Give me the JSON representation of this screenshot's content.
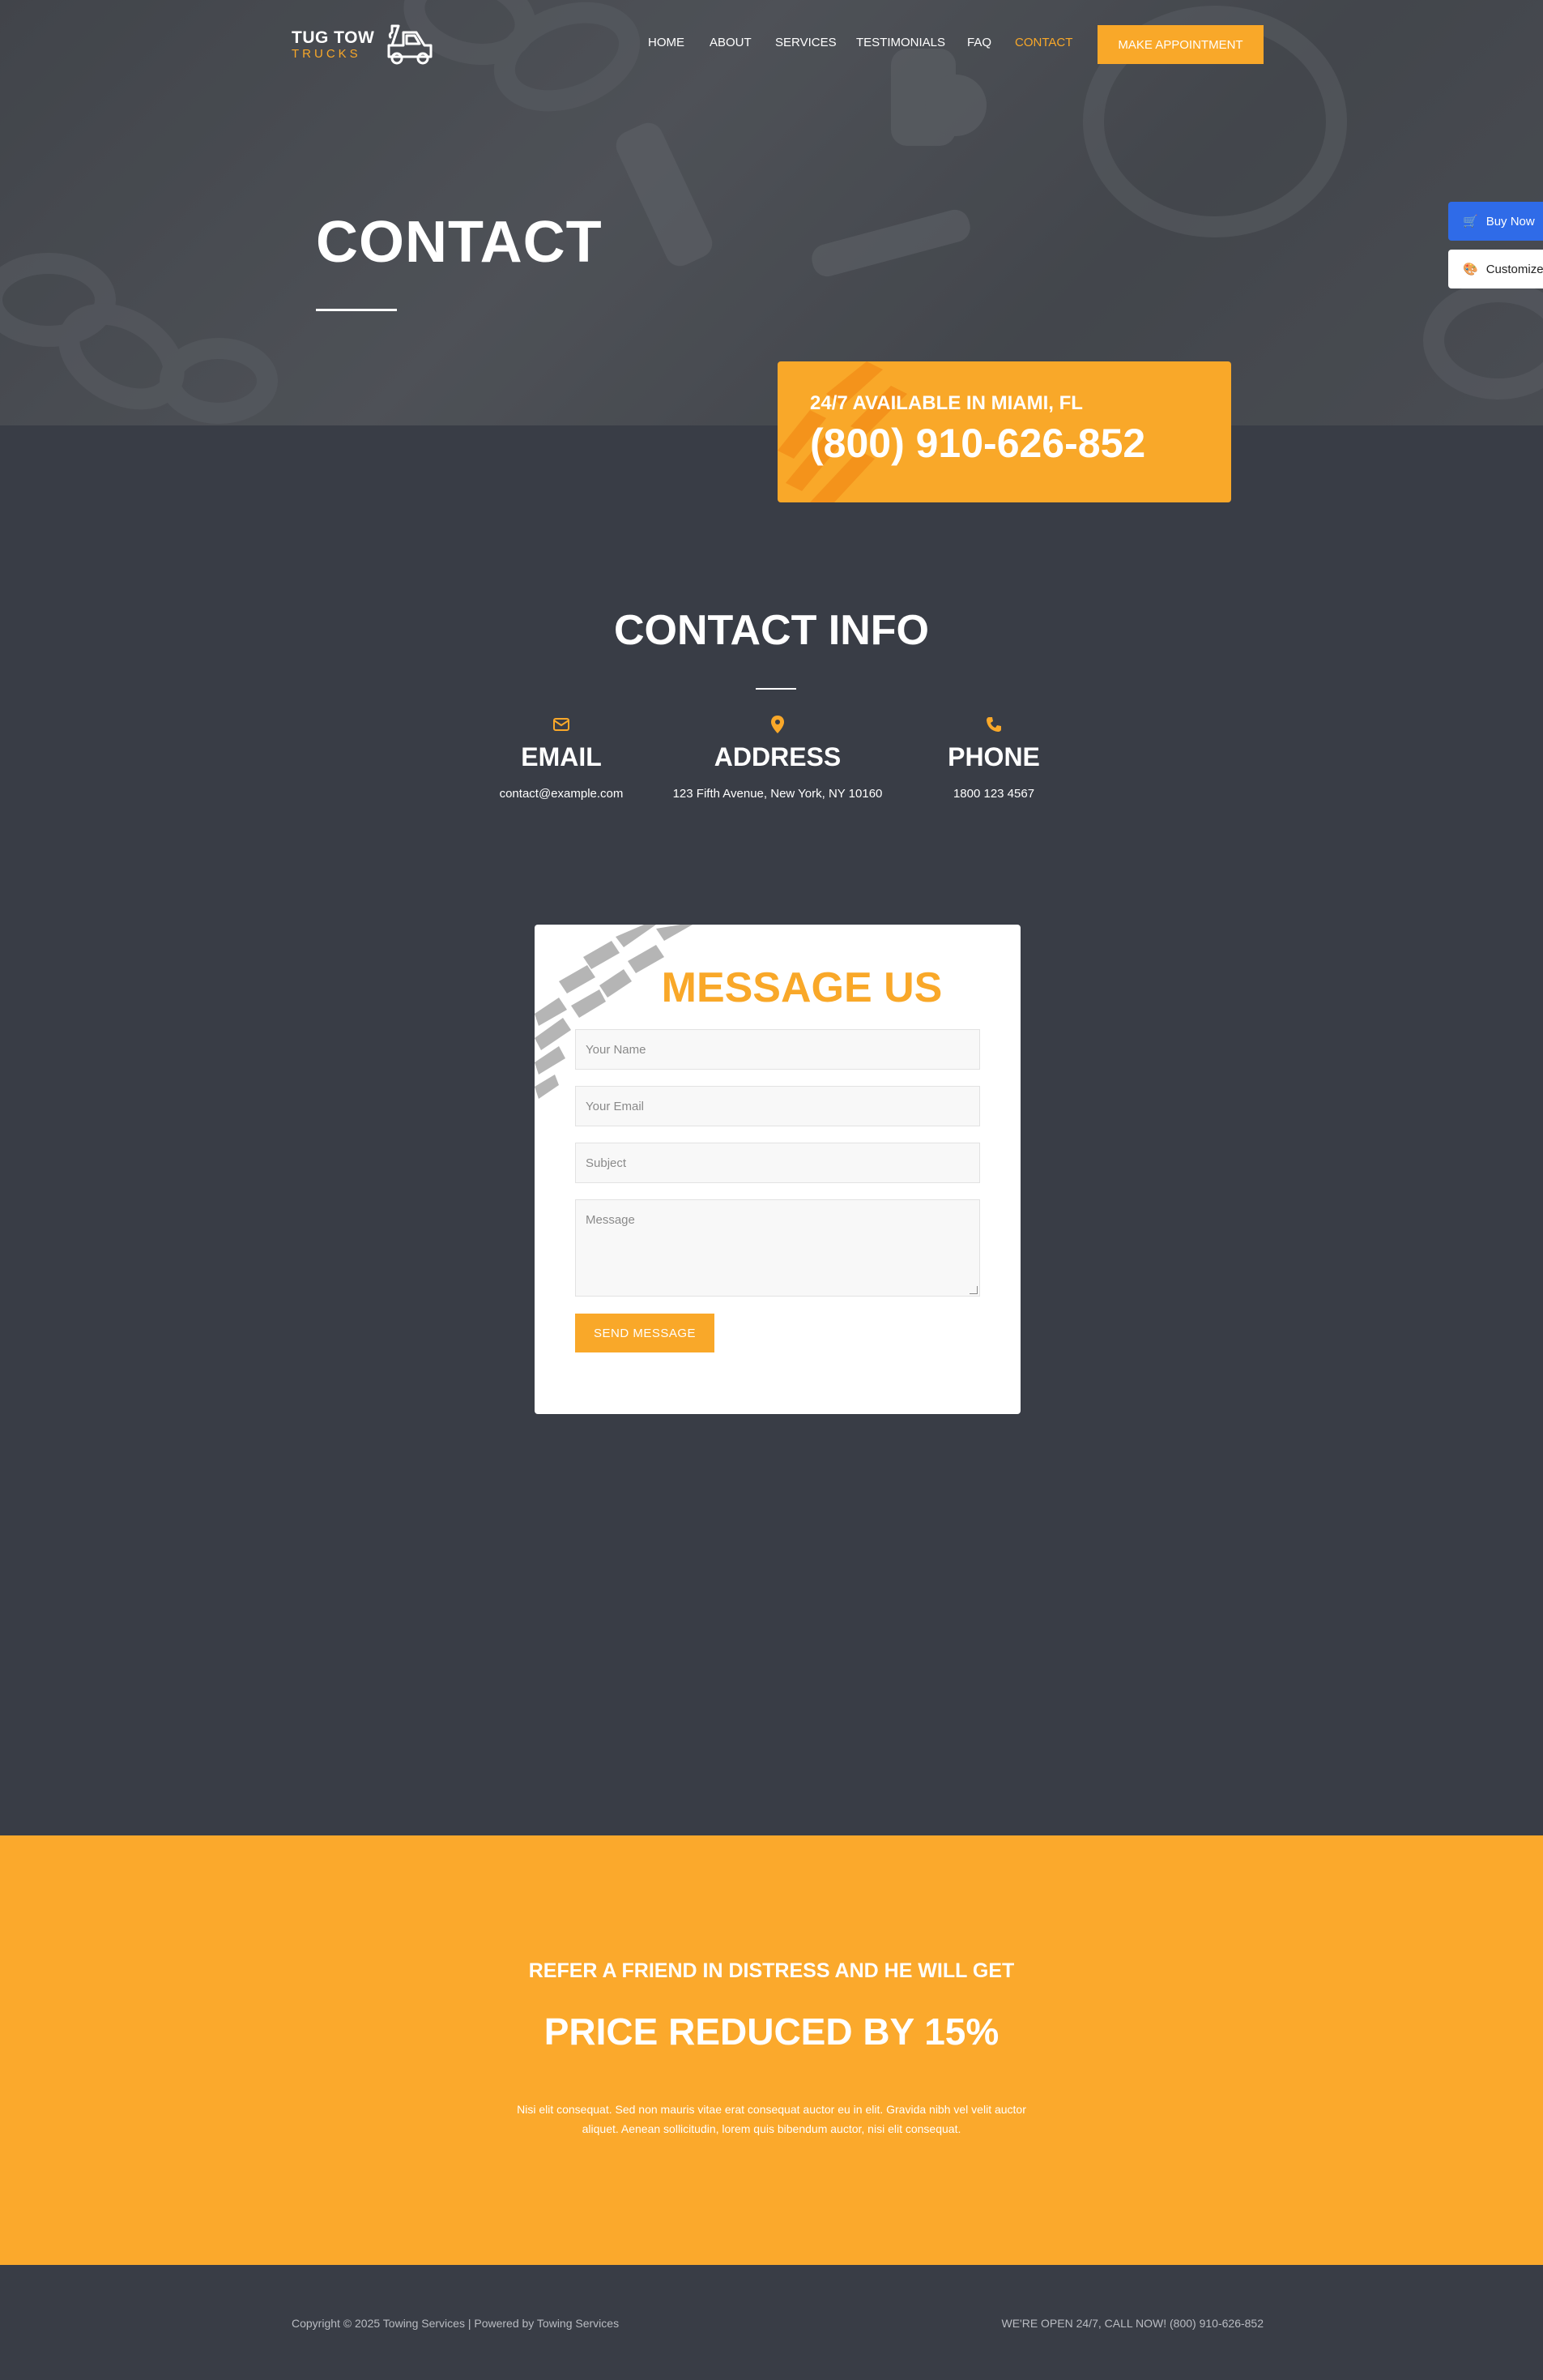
{
  "brand": {
    "top": "TUG TOW",
    "bottom": "TRUCKS",
    "accent_color": "#f9a829"
  },
  "nav": {
    "items": [
      "HOME",
      "ABOUT",
      "SERVICES",
      "TESTIMONIALS",
      "FAQ",
      "CONTACT"
    ],
    "active": "CONTACT",
    "cta": "MAKE APPOINTMENT"
  },
  "side": {
    "buy": "Buy Now",
    "customize": "Customize",
    "buy_icon": "cart-icon",
    "customize_icon": "palette-icon",
    "buy_color": "#2f6be8"
  },
  "hero": {
    "title": "CONTACT"
  },
  "call": {
    "small": "24/7 AVAILABLE IN MIAMI, FL",
    "phone": "(800) 910-626-852"
  },
  "contact_info": {
    "title": "CONTACT INFO",
    "items": [
      {
        "icon": "envelope-icon",
        "label": "EMAIL",
        "value": "contact@example.com"
      },
      {
        "icon": "map-marker-icon",
        "label": "ADDRESS",
        "value": "123 Fifth Avenue, New York, NY 10160"
      },
      {
        "icon": "phone-icon",
        "label": "PHONE",
        "value": "1800 123 4567"
      }
    ]
  },
  "form": {
    "title": "MESSAGE US",
    "name_placeholder": "Your Name",
    "email_placeholder": "Your Email",
    "subject_placeholder": "Subject",
    "message_placeholder": "Message",
    "submit": "SEND MESSAGE"
  },
  "promo": {
    "sub": "REFER A FRIEND IN DISTRESS AND HE WILL GET",
    "title": "PRICE REDUCED BY 15%",
    "text": "Nisi elit consequat. Sed non mauris vitae erat consequat auctor eu in elit. Gravida nibh vel velit auctor aliquet. Aenean sollicitudin, lorem quis bibendum auctor, nisi elit consequat."
  },
  "footer": {
    "left": "Copyright © 2025 Towing Services | Powered by Towing Services",
    "right": "WE'RE OPEN 24/7, CALL NOW! (800) 910-626-852"
  }
}
